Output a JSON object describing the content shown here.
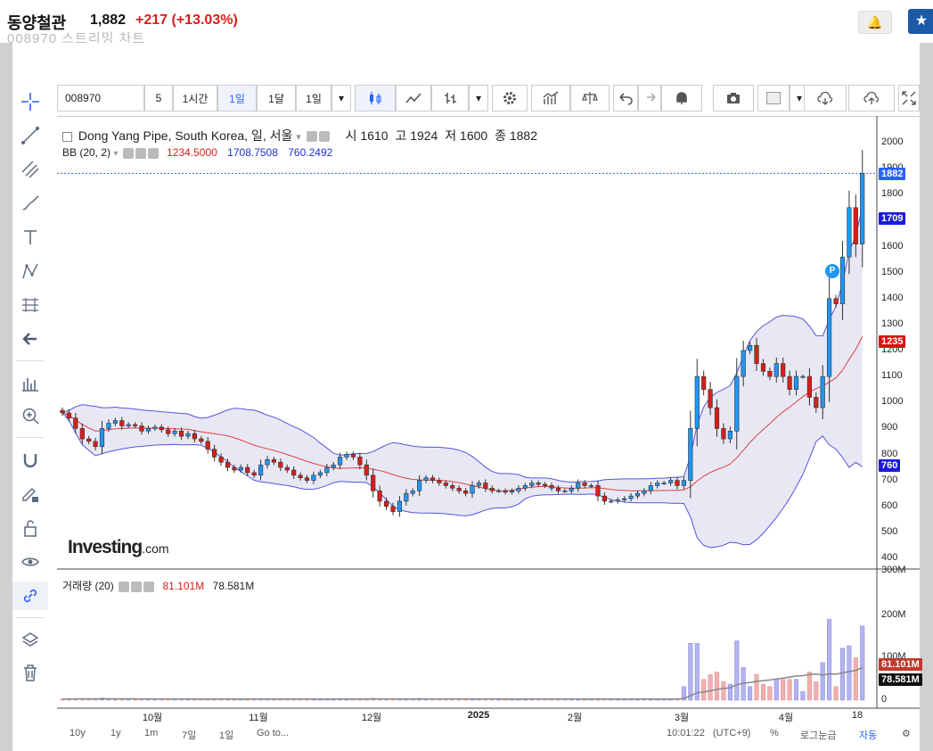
{
  "header": {
    "stock_name": "동양철관",
    "price": "1,882",
    "change": "+217",
    "change_pct": "(+13.03%)",
    "partial_text": "008970 스트리밍 차트"
  },
  "toolbar": {
    "symbol": "008970",
    "interval_value": "5",
    "period_buttons": [
      "1시간",
      "1일",
      "1달",
      "1일"
    ],
    "active_period": "1일"
  },
  "chart": {
    "legend": {
      "title": "Dong Yang Pipe, South Korea, 일, 서울",
      "open_label": "시",
      "open": "1610",
      "high_label": "고",
      "high": "1924",
      "low_label": "저",
      "low": "1600",
      "close_label": "종",
      "close": "1882"
    },
    "bb": {
      "label": "BB (20, 2)",
      "basis": "1234.5000",
      "upper": "1708.7508",
      "lower": "760.2492"
    },
    "volume": {
      "label": "거래량 (20)",
      "value1": "81.101M",
      "value2": "78.581M"
    },
    "logo": "Investing",
    "logo_suffix": ".com",
    "price_tags": {
      "close": "1882",
      "upper": "1709",
      "basis": "1235",
      "lower": "760",
      "vol": "81.101M",
      "vol_ma": "78.581M"
    },
    "bottom_bar": {
      "ranges": [
        "10y",
        "1y",
        "1m",
        "7일",
        "1일"
      ],
      "goto": "Go to...",
      "time": "10:01:22",
      "tz": "(UTC+9)",
      "pct": "%",
      "log": "로그눈금",
      "auto": "자동"
    },
    "pin_label": "P",
    "colors": {
      "up": "#2196f3",
      "down": "#d91e18",
      "bb_fill": "#e8e8f4",
      "bb_line": "#5555dd",
      "basis_line": "#e04040"
    }
  },
  "chart_data": {
    "type": "candlestick",
    "y_price_ticks": [
      2000,
      1900,
      1800,
      1700,
      1600,
      1500,
      1400,
      1300,
      1200,
      1100,
      1000,
      900,
      800,
      700,
      600,
      500,
      400
    ],
    "y_volume_ticks": [
      "300M",
      "200M",
      "100M",
      "0"
    ],
    "x_tick_labels": [
      "10월",
      "11월",
      "12월",
      "2025",
      "2월",
      "3월",
      "4월",
      "18"
    ],
    "ylim": [
      380,
      2100
    ],
    "series": [
      {
        "name": "price",
        "close": [
          960,
          940,
          900,
          860,
          850,
          830,
          900,
          920,
          930,
          910,
          915,
          910,
          890,
          900,
          905,
          895,
          880,
          890,
          870,
          880,
          860,
          850,
          820,
          790,
          770,
          750,
          740,
          750,
          730,
          720,
          760,
          780,
          770,
          750,
          740,
          720,
          710,
          700,
          720,
          730,
          750,
          760,
          790,
          800,
          790,
          760,
          720,
          660,
          620,
          600,
          580,
          620,
          650,
          660,
          700,
          710,
          700,
          690,
          680,
          670,
          660,
          650,
          680,
          690,
          670,
          660,
          660,
          655,
          660,
          670,
          680,
          690,
          685,
          680,
          670,
          660,
          660,
          670,
          690,
          680,
          680,
          640,
          620,
          620,
          625,
          630,
          640,
          650,
          660,
          680,
          690,
          690,
          700,
          680,
          700,
          900,
          1100,
          1050,
          980,
          900,
          860,
          890,
          1100,
          1200,
          1220,
          1150,
          1120,
          1100,
          1150,
          1100,
          1050,
          1100,
          1100,
          1020,
          980,
          1100,
          1400,
          1380,
          1560,
          1750,
          1610,
          1882
        ]
      }
    ]
  }
}
